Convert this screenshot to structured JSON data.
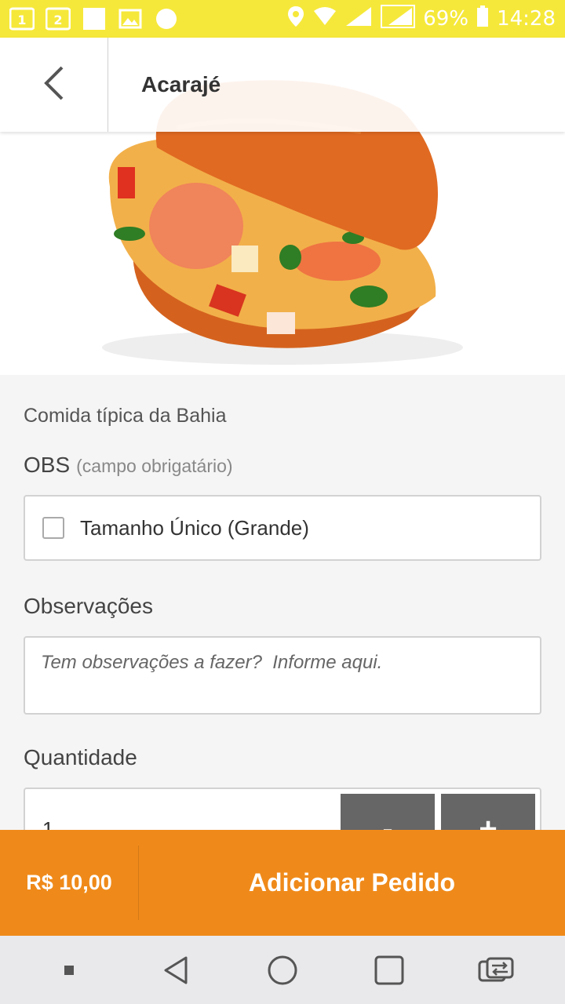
{
  "status_bar": {
    "battery": "69%",
    "time": "14:28"
  },
  "header": {
    "title": "Acarajé"
  },
  "product": {
    "description": "Comida típica da Bahia"
  },
  "obs": {
    "label": "OBS",
    "hint": "(campo obrigatário)",
    "option_label": "Tamanho Único (Grande)",
    "option_checked": false
  },
  "observacoes": {
    "label": "Observações",
    "placeholder": "Tem observações a fazer?  Informe aqui."
  },
  "quantidade": {
    "label": "Quantidade",
    "value": "1",
    "minus_label": "-",
    "plus_label": "+"
  },
  "action_bar": {
    "price": "R$ 10,00",
    "add_label": "Adicionar Pedido"
  },
  "colors": {
    "status_bar": "#f6e83a",
    "accent": "#ef8a1a",
    "stepper": "#666666"
  },
  "icons": {
    "back": "chevron-left-icon",
    "nav": [
      "square-small-icon",
      "back-triangle-icon",
      "home-circle-icon",
      "recents-square-icon",
      "switch-icon"
    ]
  }
}
